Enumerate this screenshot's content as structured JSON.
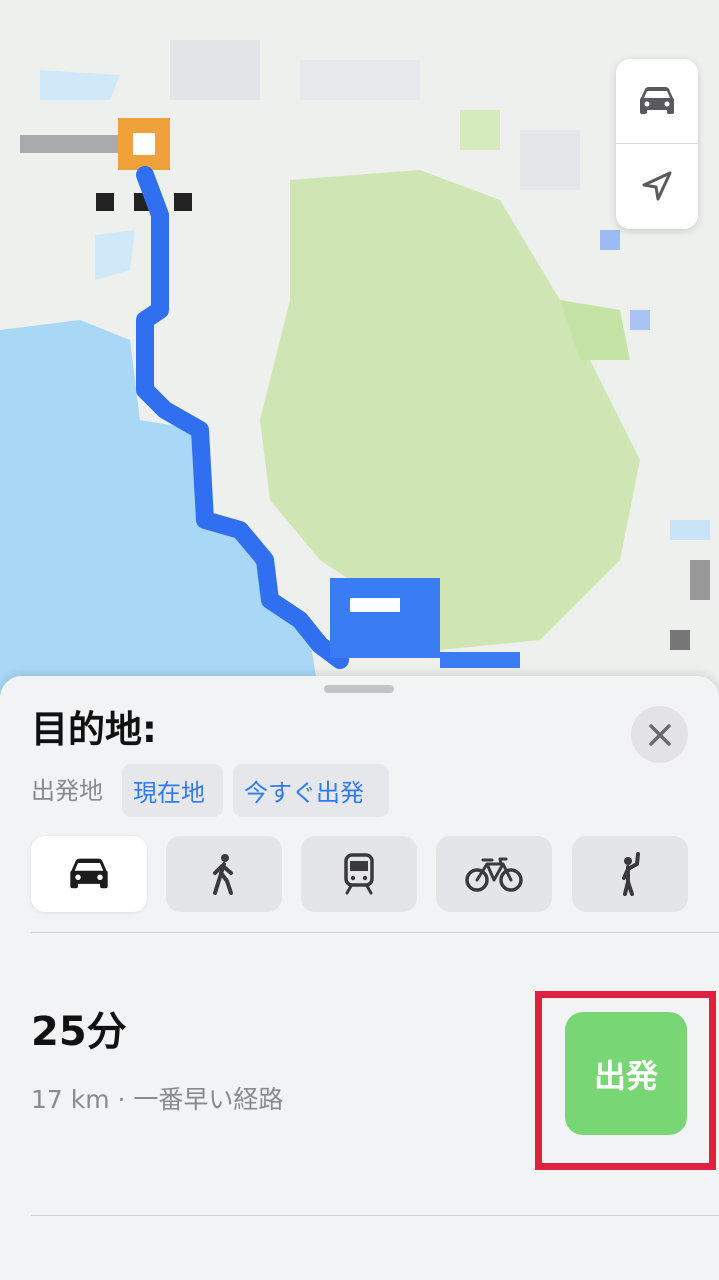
{
  "map": {
    "vehicle_icon": "car-icon",
    "location_icon": "location-arrow-icon"
  },
  "directions": {
    "title": "目的地:",
    "close_icon": "close-icon",
    "origin_label": "出発地",
    "origin_value": "現在地",
    "time_value": "今すぐ出発",
    "modes": [
      {
        "name": "drive",
        "icon": "car-icon",
        "selected": true
      },
      {
        "name": "walk",
        "icon": "walking-icon",
        "selected": false
      },
      {
        "name": "transit",
        "icon": "train-icon",
        "selected": false
      },
      {
        "name": "cycle",
        "icon": "bicycle-icon",
        "selected": false
      },
      {
        "name": "ride",
        "icon": "hail-ride-icon",
        "selected": false
      }
    ]
  },
  "route": {
    "duration": "25分",
    "detail": "17 km · 一番早い経路",
    "go_label": "出発"
  },
  "colors": {
    "accent": "#2f7bf5",
    "go_button": "#78d674",
    "highlight": "#e0213f",
    "route_line": "#2f6ff0"
  }
}
